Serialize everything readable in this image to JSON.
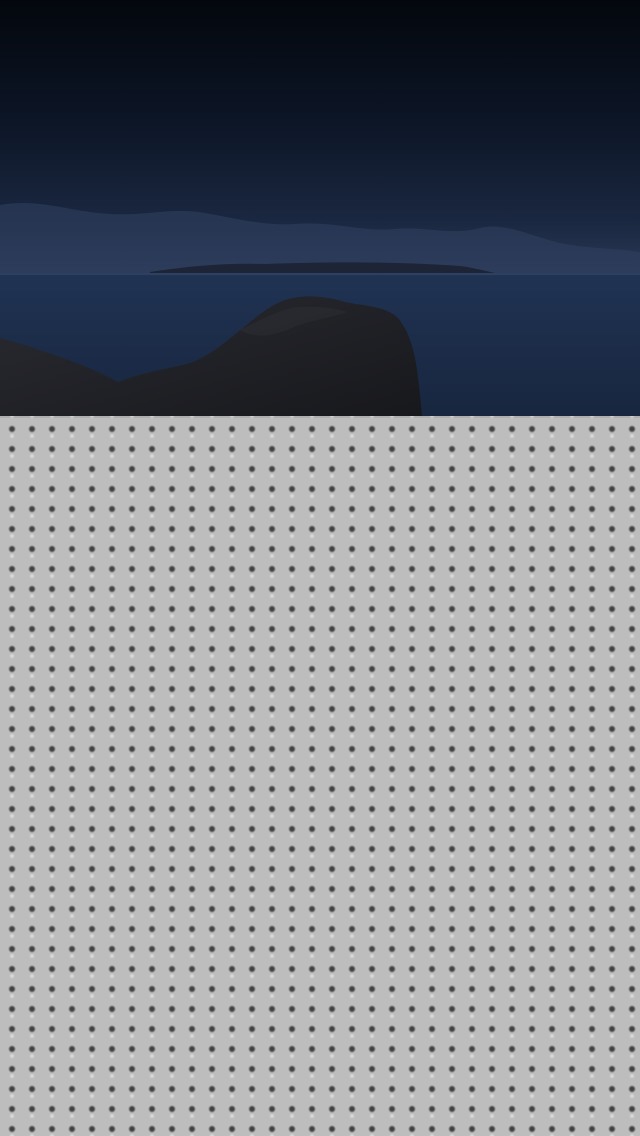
{
  "screen": {
    "wallpaper": {
      "scene": "",
      "colors": {
        "sky_top": "#04080f",
        "sky_mid": "#101a2d",
        "horizon_glow": "#2b3b57",
        "sea": "#1c2c46",
        "rock": "#1f2026"
      }
    },
    "panel": {
      "texture": "perforated-metal",
      "colors": {
        "base": "#bdbdbd",
        "hole": "#3a3a3a"
      }
    }
  }
}
